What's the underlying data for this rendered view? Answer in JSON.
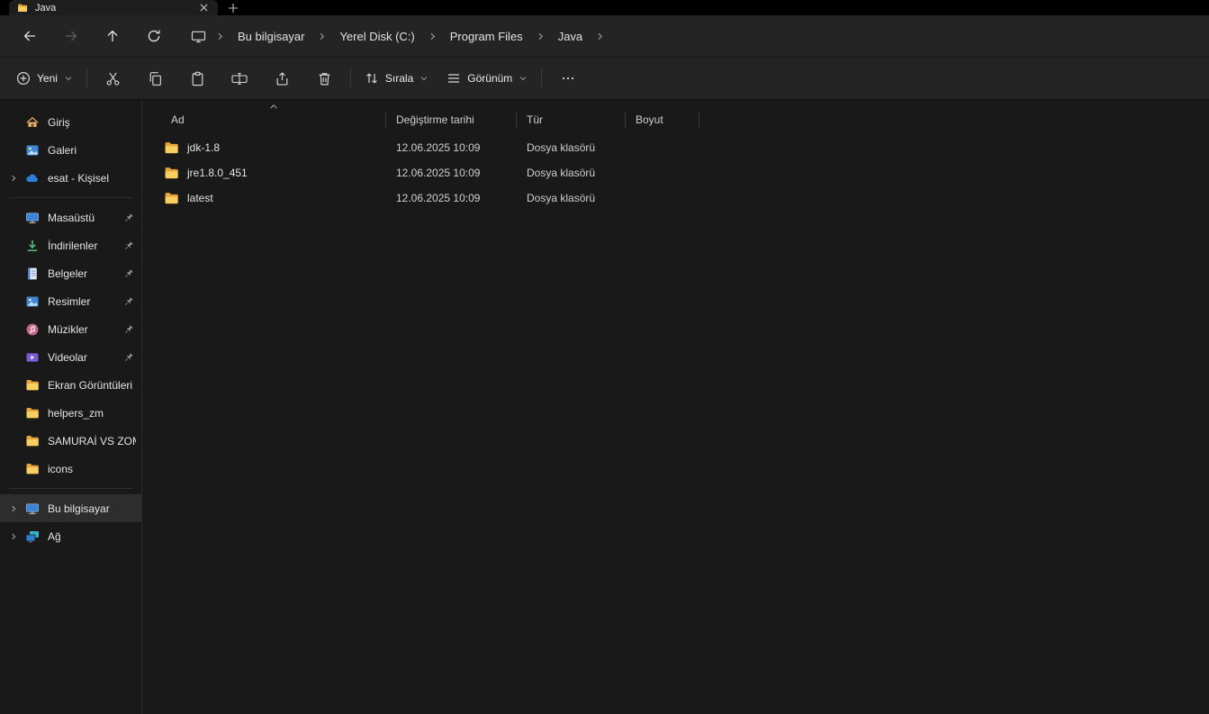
{
  "tab": {
    "title": "Java"
  },
  "nav": {
    "breadcrumb": [
      "Bu bilgisayar",
      "Yerel Disk (C:)",
      "Program Files",
      "Java"
    ]
  },
  "toolbar": {
    "new": "Yeni",
    "sort": "Sırala",
    "view": "Görünüm"
  },
  "sidebar": {
    "top": [
      {
        "label": "Giriş"
      },
      {
        "label": "Galeri"
      },
      {
        "label": "esat - Kişisel"
      }
    ],
    "pinned": [
      {
        "label": "Masaüstü"
      },
      {
        "label": "İndirilenler"
      },
      {
        "label": "Belgeler"
      },
      {
        "label": "Resimler"
      },
      {
        "label": "Müzikler"
      },
      {
        "label": "Videolar"
      }
    ],
    "folders": [
      {
        "label": "Ekran Görüntüleri"
      },
      {
        "label": "helpers_zm"
      },
      {
        "label": "SAMURAİ VS ZOMB"
      },
      {
        "label": "icons"
      }
    ],
    "bottom": [
      {
        "label": "Bu bilgisayar"
      },
      {
        "label": "Ağ"
      }
    ]
  },
  "files": {
    "columns": {
      "name": "Ad",
      "modified": "Değiştirme tarihi",
      "type": "Tür",
      "size": "Boyut"
    },
    "rows": [
      {
        "name": "jdk-1.8",
        "modified": "12.06.2025 10:09",
        "type": "Dosya klasörü",
        "size": ""
      },
      {
        "name": "jre1.8.0_451",
        "modified": "12.06.2025 10:09",
        "type": "Dosya klasörü",
        "size": ""
      },
      {
        "name": "latest",
        "modified": "12.06.2025 10:09",
        "type": "Dosya klasörü",
        "size": ""
      }
    ]
  }
}
